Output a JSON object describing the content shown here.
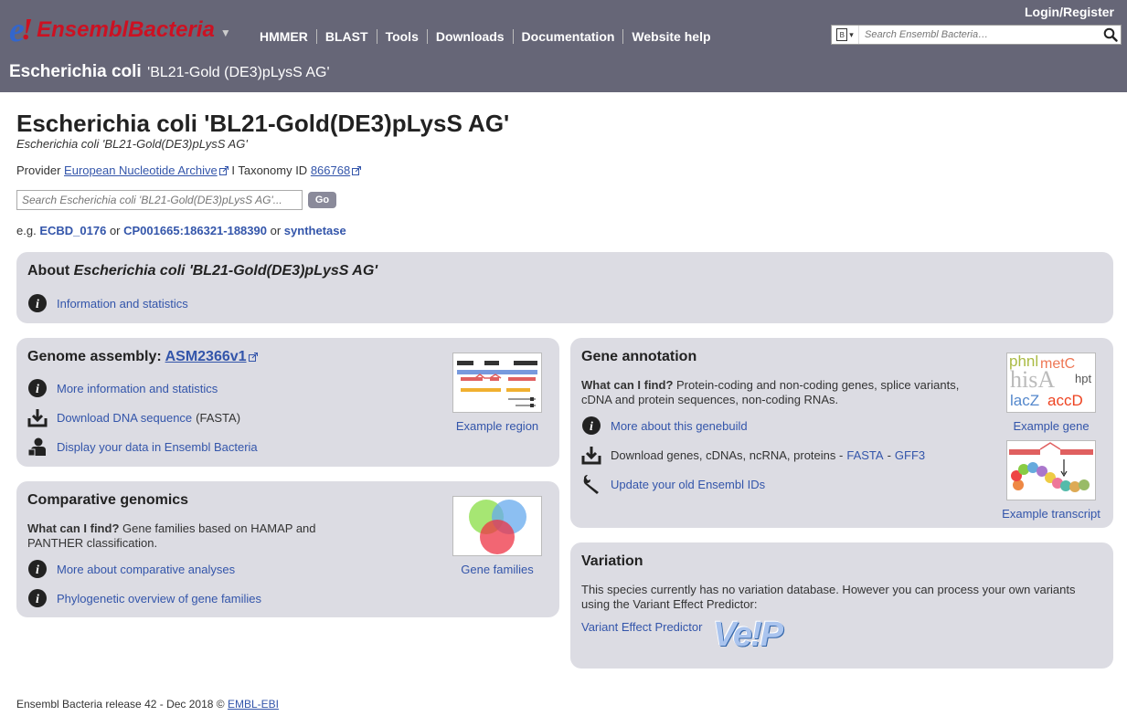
{
  "header": {
    "logo_prefix": "e",
    "logo_bang": "!",
    "logo_name": "EnsemblBacteria",
    "nav": [
      "HMMER",
      "BLAST",
      "Tools",
      "Downloads",
      "Documentation",
      "Website help"
    ],
    "login": "Login/Register",
    "search_placeholder": "Search Ensembl Bacteria…",
    "species_name": "Escherichia coli",
    "species_strain": "'BL21-Gold (DE3)pLysS AG'"
  },
  "main": {
    "title": "Escherichia coli 'BL21-Gold(DE3)pLysS AG'",
    "subtitle": "Escherichia coli 'BL21-Gold(DE3)pLysS AG'",
    "provider_label": "Provider",
    "provider_link": "European Nucleotide Archive",
    "taxonomy_label": "I Taxonomy ID",
    "taxonomy_id": "866768",
    "search_placeholder": "Search Escherichia coli 'BL21-Gold(DE3)pLysS AG'...",
    "go_label": "Go",
    "examples_prefix": "e.g.",
    "example_1": "ECBD_0176",
    "or_1": "or",
    "example_2": "CP001665:186321-188390",
    "or_2": "or",
    "example_3": "synthetase"
  },
  "about": {
    "heading_prefix": "About",
    "heading_species": "Escherichia coli 'BL21-Gold(DE3)pLysS AG'",
    "info_link": "Information and statistics"
  },
  "genome": {
    "heading": "Genome assembly:",
    "assembly": "ASM2366v1",
    "more_info": "More information and statistics",
    "download": "Download DNA sequence",
    "download_suffix": "(FASTA)",
    "display": "Display your data in Ensembl Bacteria",
    "example_label": "Example region"
  },
  "comparative": {
    "heading": "Comparative genomics",
    "what_label": "What can I find?",
    "what_text": "Gene families based on HAMAP and PANTHER classification.",
    "more_about": "More about comparative analyses",
    "phylo": "Phylogenetic overview of gene families",
    "example_label": "Gene families"
  },
  "annotation": {
    "heading": "Gene annotation",
    "what_label": "What can I find?",
    "what_text": "Protein-coding and non-coding genes, splice variants, cDNA and protein sequences, non-coding RNAs.",
    "more_about": "More about this genebuild",
    "download_text": "Download genes, cDNAs, ncRNA, proteins -",
    "fasta": "FASTA",
    "dash": "-",
    "gff3": "GFF3",
    "update_ids": "Update your old Ensembl IDs",
    "example_gene_label": "Example gene",
    "example_transcript_label": "Example transcript",
    "gene_words": [
      "phnl",
      "metC",
      "hisA",
      "hpt",
      "lacZ",
      "accD"
    ]
  },
  "variation": {
    "heading": "Variation",
    "text": "This species currently has no variation database. However you can process your own variants using the Variant Effect Predictor:",
    "vep_link": "Variant Effect Predictor",
    "vep_logo": "Ve!P"
  },
  "footer": {
    "text": "Ensembl Bacteria release 42 - Dec 2018 ©",
    "link": "EMBL-EBI"
  },
  "colors": {
    "masthead": "#666677",
    "panel": "#dcdce3",
    "link": "#3355aa",
    "logo_red": "#cc1122",
    "logo_blue": "#3366cc"
  }
}
